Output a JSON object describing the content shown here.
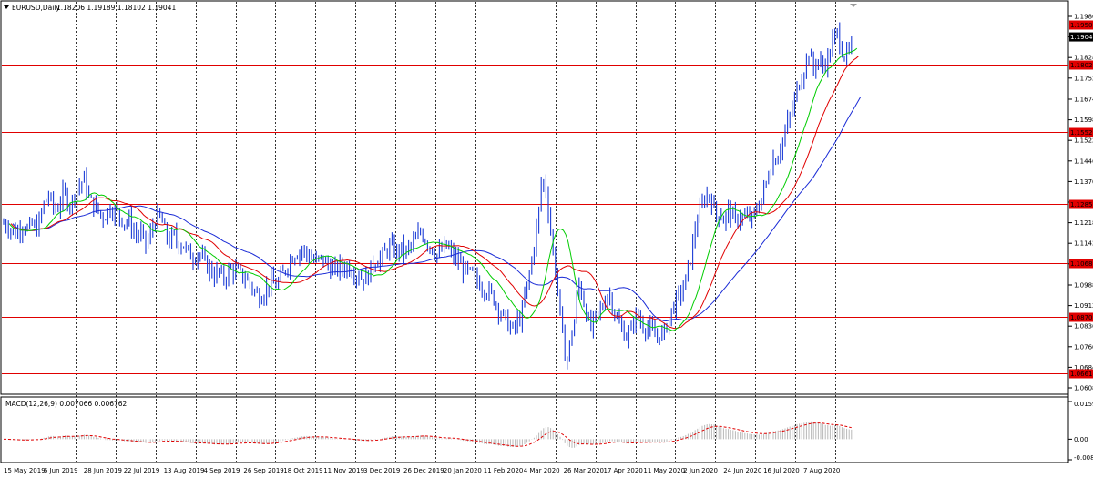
{
  "window": {
    "menu_arrow": "triangle-down",
    "title": "EURUSD,Daily",
    "ohlc": "1.18206 1.19189 1.18102 1.19041"
  },
  "macd_panel": {
    "title": "MACD(12,26,9) 0.007066 0.006762",
    "scale": [
      "0.015993",
      "0.00",
      "-0.008744"
    ]
  },
  "colors": {
    "bull_bar": "#1a3bd6",
    "ma_fast": "#00cc00",
    "ma_mid": "#e00000",
    "ma_slow": "#1a2bd6",
    "level_line": "#e00000",
    "price_tag": "#000000"
  },
  "price_axis": [
    "1.19800",
    "1.19041",
    "1.18280",
    "1.17520",
    "1.16740",
    "1.15980",
    "1.15220",
    "1.14460",
    "1.13700",
    "1.12940",
    "1.12180",
    "1.11420",
    "1.10660",
    "1.09880",
    "1.09120",
    "1.08360",
    "1.07600",
    "1.06840",
    "1.06080"
  ],
  "current_price": "1.19041",
  "levels": [
    "1.19500",
    "1.18023",
    "1.15529",
    "1.12857",
    "1.10685",
    "1.08709",
    "1.06614"
  ],
  "time_axis": [
    "15 May 2019",
    "6 Jun 2019",
    "28 Jun 2019",
    "22 Jul 2019",
    "13 Aug 2019",
    "4 Sep 2019",
    "26 Sep 2019",
    "18 Oct 2019",
    "11 Nov 2019",
    "3 Dec 2019",
    "26 Dec 2019",
    "20 Jan 2020",
    "11 Feb 2020",
    "4 Mar 2020",
    "26 Mar 2020",
    "17 Apr 2020",
    "11 May 2020",
    "2 Jun 2020",
    "24 Jun 2020",
    "16 Jul 2020",
    "7 Aug 2020"
  ],
  "price_path": [
    [
      0,
      1.1215
    ],
    [
      5,
      1.1205
    ],
    [
      9,
      1.119
    ],
    [
      13,
      1.118
    ],
    [
      18,
      1.12
    ],
    [
      22,
      1.1215
    ],
    [
      27,
      1.119
    ],
    [
      31,
      1.121
    ],
    [
      36,
      1.1195
    ],
    [
      40,
      1.123
    ],
    [
      44,
      1.1285
    ],
    [
      49,
      1.132
    ],
    [
      53,
      1.1285
    ],
    [
      58,
      1.126
    ],
    [
      62,
      1.13
    ],
    [
      67,
      1.133
    ],
    [
      71,
      1.129
    ],
    [
      76,
      1.13
    ],
    [
      80,
      1.134
    ],
    [
      85,
      1.1365
    ],
    [
      89,
      1.138
    ],
    [
      93,
      1.131
    ],
    [
      98,
      1.1285
    ],
    [
      102,
      1.127
    ],
    [
      107,
      1.1245
    ],
    [
      111,
      1.124
    ],
    [
      116,
      1.1275
    ],
    [
      120,
      1.1265
    ],
    [
      124,
      1.126
    ],
    [
      129,
      1.1235
    ],
    [
      133,
      1.122
    ],
    [
      138,
      1.1225
    ],
    [
      142,
      1.119
    ],
    [
      147,
      1.117
    ],
    [
      151,
      1.1175
    ],
    [
      156,
      1.114
    ],
    [
      160,
      1.116
    ],
    [
      164,
      1.121
    ],
    [
      169,
      1.124
    ],
    [
      173,
      1.123
    ],
    [
      178,
      1.1175
    ],
    [
      182,
      1.115
    ],
    [
      187,
      1.117
    ],
    [
      191,
      1.114
    ],
    [
      196,
      1.1145
    ],
    [
      200,
      1.112
    ],
    [
      204,
      1.11
    ],
    [
      209,
      1.109
    ],
    [
      213,
      1.111
    ],
    [
      218,
      1.1085
    ],
    [
      222,
      1.106
    ],
    [
      227,
      1.105
    ],
    [
      231,
      1.102
    ],
    [
      236,
      1.104
    ],
    [
      240,
      1.101
    ],
    [
      244,
      1.102
    ],
    [
      249,
      1.105
    ],
    [
      253,
      1.104
    ],
    [
      258,
      1.1035
    ],
    [
      262,
      1.102
    ],
    [
      267,
      1.101
    ],
    [
      271,
      1.099
    ],
    [
      276,
      1.096
    ],
    [
      280,
      1.0945
    ],
    [
      284,
      1.0955
    ],
    [
      289,
      1.098
    ],
    [
      293,
      1.1
    ],
    [
      298,
      1.0985
    ],
    [
      302,
      1.1
    ],
    [
      307,
      1.103
    ],
    [
      311,
      1.106
    ],
    [
      316,
      1.109
    ],
    [
      320,
      1.1105
    ],
    [
      324,
      1.111
    ],
    [
      329,
      1.112
    ],
    [
      333,
      1.11
    ],
    [
      338,
      1.109
    ],
    [
      342,
      1.107
    ],
    [
      347,
      1.1085
    ],
    [
      351,
      1.108
    ],
    [
      356,
      1.106
    ],
    [
      360,
      1.105
    ],
    [
      364,
      1.104
    ],
    [
      369,
      1.1055
    ],
    [
      373,
      1.105
    ],
    [
      378,
      1.106
    ],
    [
      382,
      1.1045
    ],
    [
      387,
      1.103
    ],
    [
      391,
      1.102
    ],
    [
      396,
      1.101
    ],
    [
      400,
      1.102
    ],
    [
      404,
      1.106
    ],
    [
      409,
      1.108
    ],
    [
      413,
      1.1085
    ],
    [
      418,
      1.11
    ],
    [
      422,
      1.113
    ],
    [
      427,
      1.1125
    ],
    [
      431,
      1.111
    ],
    [
      436,
      1.1125
    ],
    [
      440,
      1.1105
    ],
    [
      444,
      1.112
    ],
    [
      449,
      1.114
    ],
    [
      453,
      1.1155
    ],
    [
      458,
      1.119
    ],
    [
      462,
      1.116
    ],
    [
      467,
      1.114
    ],
    [
      471,
      1.112
    ],
    [
      476,
      1.11
    ],
    [
      480,
      1.111
    ],
    [
      484,
      1.113
    ],
    [
      489,
      1.112
    ],
    [
      493,
      1.1095
    ],
    [
      498,
      1.108
    ],
    [
      502,
      1.106
    ],
    [
      507,
      1.104
    ],
    [
      511,
      1.103
    ],
    [
      516,
      1.1025
    ],
    [
      520,
      1.1
    ],
    [
      524,
      1.099
    ],
    [
      529,
      1.097
    ],
    [
      533,
      1.096
    ],
    [
      538,
      1.094
    ],
    [
      542,
      1.091
    ],
    [
      547,
      1.088
    ],
    [
      551,
      1.086
    ],
    [
      556,
      1.083
    ],
    [
      560,
      1.082
    ],
    [
      564,
      1.085
    ],
    [
      569,
      1.088
    ],
    [
      573,
      1.096
    ],
    [
      578,
      1.104
    ],
    [
      582,
      1.113
    ],
    [
      587,
      1.124
    ],
    [
      591,
      1.139
    ],
    [
      596,
      1.133
    ],
    [
      600,
      1.121
    ],
    [
      604,
      1.108
    ],
    [
      609,
      1.096
    ],
    [
      613,
      1.08
    ],
    [
      618,
      1.07
    ],
    [
      622,
      1.078
    ],
    [
      627,
      1.086
    ],
    [
      631,
      1.1
    ],
    [
      636,
      1.094
    ],
    [
      640,
      1.088
    ],
    [
      644,
      1.082
    ],
    [
      649,
      1.086
    ],
    [
      653,
      1.088
    ],
    [
      658,
      1.091
    ],
    [
      662,
      1.096
    ],
    [
      667,
      1.094
    ],
    [
      671,
      1.088
    ],
    [
      676,
      1.084
    ],
    [
      680,
      1.082
    ],
    [
      684,
      1.08
    ],
    [
      689,
      1.082
    ],
    [
      693,
      1.088
    ],
    [
      698,
      1.086
    ],
    [
      702,
      1.084
    ],
    [
      707,
      1.083
    ],
    [
      711,
      1.082
    ],
    [
      716,
      1.079
    ],
    [
      720,
      1.081
    ],
    [
      724,
      1.08
    ],
    [
      729,
      1.085
    ],
    [
      733,
      1.089
    ],
    [
      738,
      1.093
    ],
    [
      742,
      1.095
    ],
    [
      747,
      1.098
    ],
    [
      751,
      1.104
    ],
    [
      756,
      1.112
    ],
    [
      760,
      1.122
    ],
    [
      764,
      1.125
    ],
    [
      769,
      1.131
    ],
    [
      773,
      1.132
    ],
    [
      778,
      1.13
    ],
    [
      782,
      1.124
    ],
    [
      787,
      1.126
    ],
    [
      791,
      1.122
    ],
    [
      796,
      1.127
    ],
    [
      800,
      1.124
    ],
    [
      804,
      1.122
    ],
    [
      809,
      1.125
    ],
    [
      813,
      1.123
    ],
    [
      818,
      1.124
    ],
    [
      822,
      1.123
    ],
    [
      827,
      1.127
    ],
    [
      831,
      1.13
    ],
    [
      836,
      1.135
    ],
    [
      840,
      1.14
    ],
    [
      844,
      1.145
    ],
    [
      849,
      1.146
    ],
    [
      853,
      1.15
    ],
    [
      858,
      1.155
    ],
    [
      862,
      1.16
    ],
    [
      867,
      1.165
    ],
    [
      871,
      1.171
    ],
    [
      876,
      1.176
    ],
    [
      880,
      1.18
    ],
    [
      884,
      1.185
    ],
    [
      889,
      1.178
    ],
    [
      893,
      1.183
    ],
    [
      898,
      1.179
    ],
    [
      902,
      1.181
    ],
    [
      907,
      1.184
    ],
    [
      911,
      1.19
    ],
    [
      916,
      1.192
    ],
    [
      920,
      1.186
    ],
    [
      924,
      1.183
    ],
    [
      929,
      1.185
    ],
    [
      933,
      1.188
    ],
    [
      936,
      1.1904
    ]
  ],
  "chart_data": [
    {
      "type": "line",
      "title": "EURUSD,Daily",
      "x": [
        "15 May 2019",
        "6 Jun 2019",
        "28 Jun 2019",
        "22 Jul 2019",
        "13 Aug 2019",
        "4 Sep 2019",
        "26 Sep 2019",
        "18 Oct 2019",
        "11 Nov 2019",
        "3 Dec 2019",
        "26 Dec 2019",
        "20 Jan 2020",
        "11 Feb 2020",
        "4 Mar 2020",
        "26 Mar 2020",
        "17 Apr 2020",
        "11 May 2020",
        "2 Jun 2020",
        "24 Jun 2020",
        "16 Jul 2020",
        "7 Aug 2020"
      ],
      "series": [
        {
          "values": [
            1.12,
            1.128,
            1.133,
            1.125,
            1.118,
            1.102,
            1.095,
            1.109,
            1.103,
            1.108,
            1.117,
            1.106,
            1.083,
            1.125,
            1.088,
            1.084,
            1.082,
            1.125,
            1.125,
            1.17,
            1.185
          ]
        }
      ],
      "ylim": [
        1.0608,
        1.198
      ],
      "grid": true,
      "horizontal_levels": [
        1.195,
        1.18023,
        1.15529,
        1.12857,
        1.10685,
        1.08709,
        1.06614
      ],
      "last_price": 1.19041
    },
    {
      "type": "bar",
      "title": "MACD(12,26,9) 0.007066 0.006762",
      "x": [
        "15 May 2019",
        "6 Jun 2019",
        "28 Jun 2019",
        "22 Jul 2019",
        "13 Aug 2019",
        "4 Sep 2019",
        "26 Sep 2019",
        "18 Oct 2019",
        "11 Nov 2019",
        "3 Dec 2019",
        "26 Dec 2019",
        "20 Jan 2020",
        "11 Feb 2020",
        "4 Mar 2020",
        "26 Mar 2020",
        "17 Apr 2020",
        "11 May 2020",
        "2 Jun 2020",
        "24 Jun 2020",
        "16 Jul 2020",
        "7 Aug 2020"
      ],
      "series": [
        {
          "values": [
            -0.0005,
            0.0015,
            0.0025,
            -0.0005,
            -0.0015,
            -0.002,
            -0.002,
            0.0005,
            -0.0002,
            0.0,
            0.001,
            -0.001,
            -0.003,
            0.007,
            -0.002,
            -0.001,
            -0.0005,
            0.01,
            0.0095,
            0.0145,
            0.0135
          ]
        },
        {
          "values": [
            -0.0003,
            0.0005,
            0.002,
            0.0005,
            -0.001,
            -0.0018,
            -0.002,
            -0.0003,
            0.0,
            0.0002,
            0.0007,
            -0.0003,
            -0.0025,
            0.005,
            0.0,
            -0.0015,
            -0.001,
            0.006,
            0.008,
            0.012,
            0.014
          ]
        }
      ],
      "ylim": [
        -0.008744,
        0.015993
      ]
    }
  ]
}
